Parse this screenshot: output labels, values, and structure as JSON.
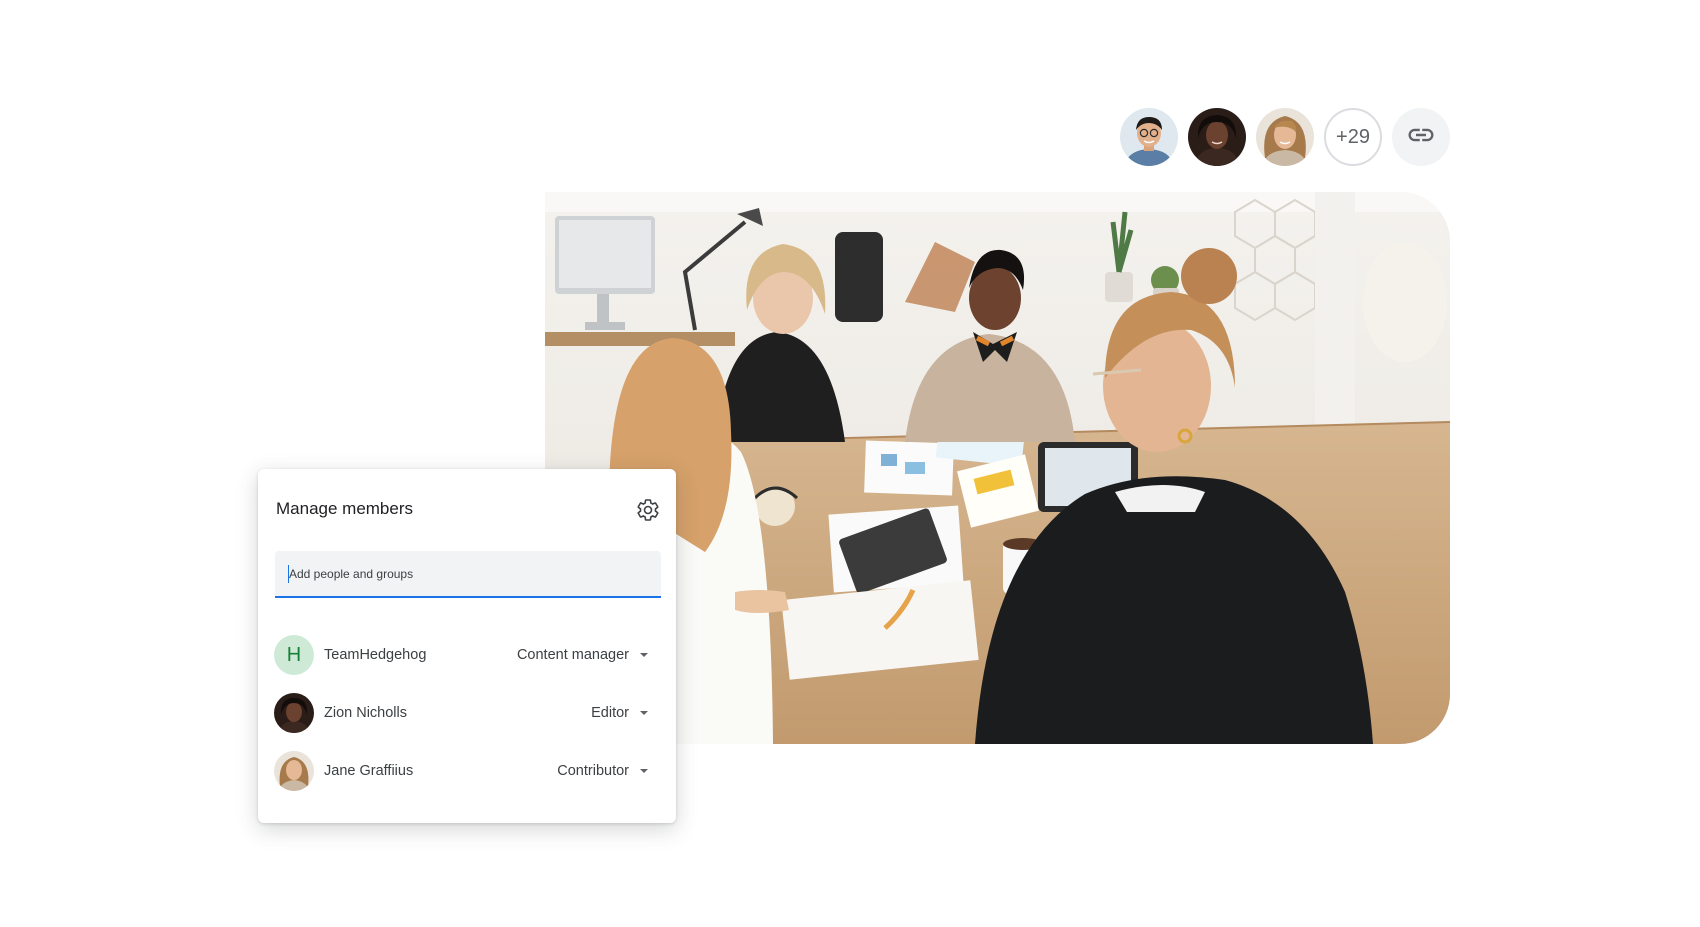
{
  "header": {
    "avatars": [
      {
        "name": "avatar-man-glasses"
      },
      {
        "name": "avatar-woman-dark-hair"
      },
      {
        "name": "avatar-woman-curly-hair"
      }
    ],
    "overflow_count": "+29",
    "link_icon": "link-icon"
  },
  "card": {
    "title": "Manage members",
    "settings_icon": "gear-icon",
    "search": {
      "placeholder": "Add people and groups",
      "value": ""
    },
    "members": [
      {
        "name": "TeamHedgehog",
        "avatar_letter": "H",
        "role": "Content manager"
      },
      {
        "name": "Zion Nicholls",
        "role": "Editor"
      },
      {
        "name": "Jane Graffiius",
        "role": "Contributor"
      }
    ]
  },
  "colors": {
    "accent": "#1a73e8",
    "group_avatar_bg": "#ceead6",
    "group_avatar_fg": "#188038",
    "text": "#3c4043"
  }
}
